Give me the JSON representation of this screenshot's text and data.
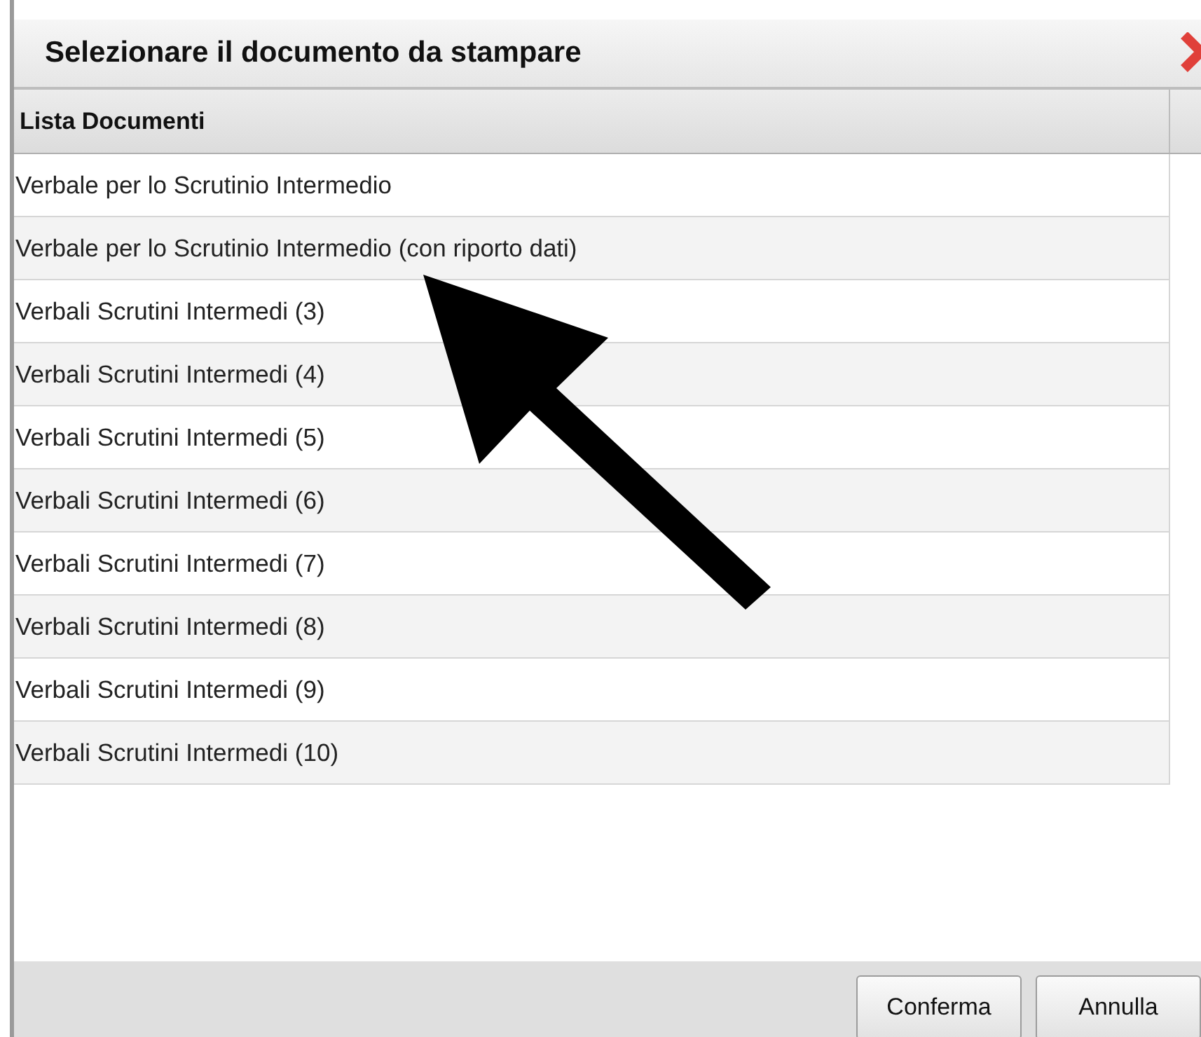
{
  "dialog": {
    "title": "Selezionare il documento da stampare"
  },
  "table": {
    "columns": [
      "Lista Documenti"
    ],
    "rows": [
      {
        "label": "Verbale per lo Scrutinio Intermedio"
      },
      {
        "label": "Verbale per lo Scrutinio Intermedio (con riporto dati)"
      },
      {
        "label": "Verbali Scrutini Intermedi (3)"
      },
      {
        "label": "Verbali Scrutini Intermedi (4)"
      },
      {
        "label": "Verbali Scrutini Intermedi (5)"
      },
      {
        "label": "Verbali Scrutini Intermedi (6)"
      },
      {
        "label": "Verbali Scrutini Intermedi (7)"
      },
      {
        "label": "Verbali Scrutini Intermedi (8)"
      },
      {
        "label": "Verbali Scrutini Intermedi (9)"
      },
      {
        "label": "Verbali Scrutini Intermedi (10)"
      }
    ]
  },
  "buttons": [
    "Conferma",
    "Annulla"
  ]
}
